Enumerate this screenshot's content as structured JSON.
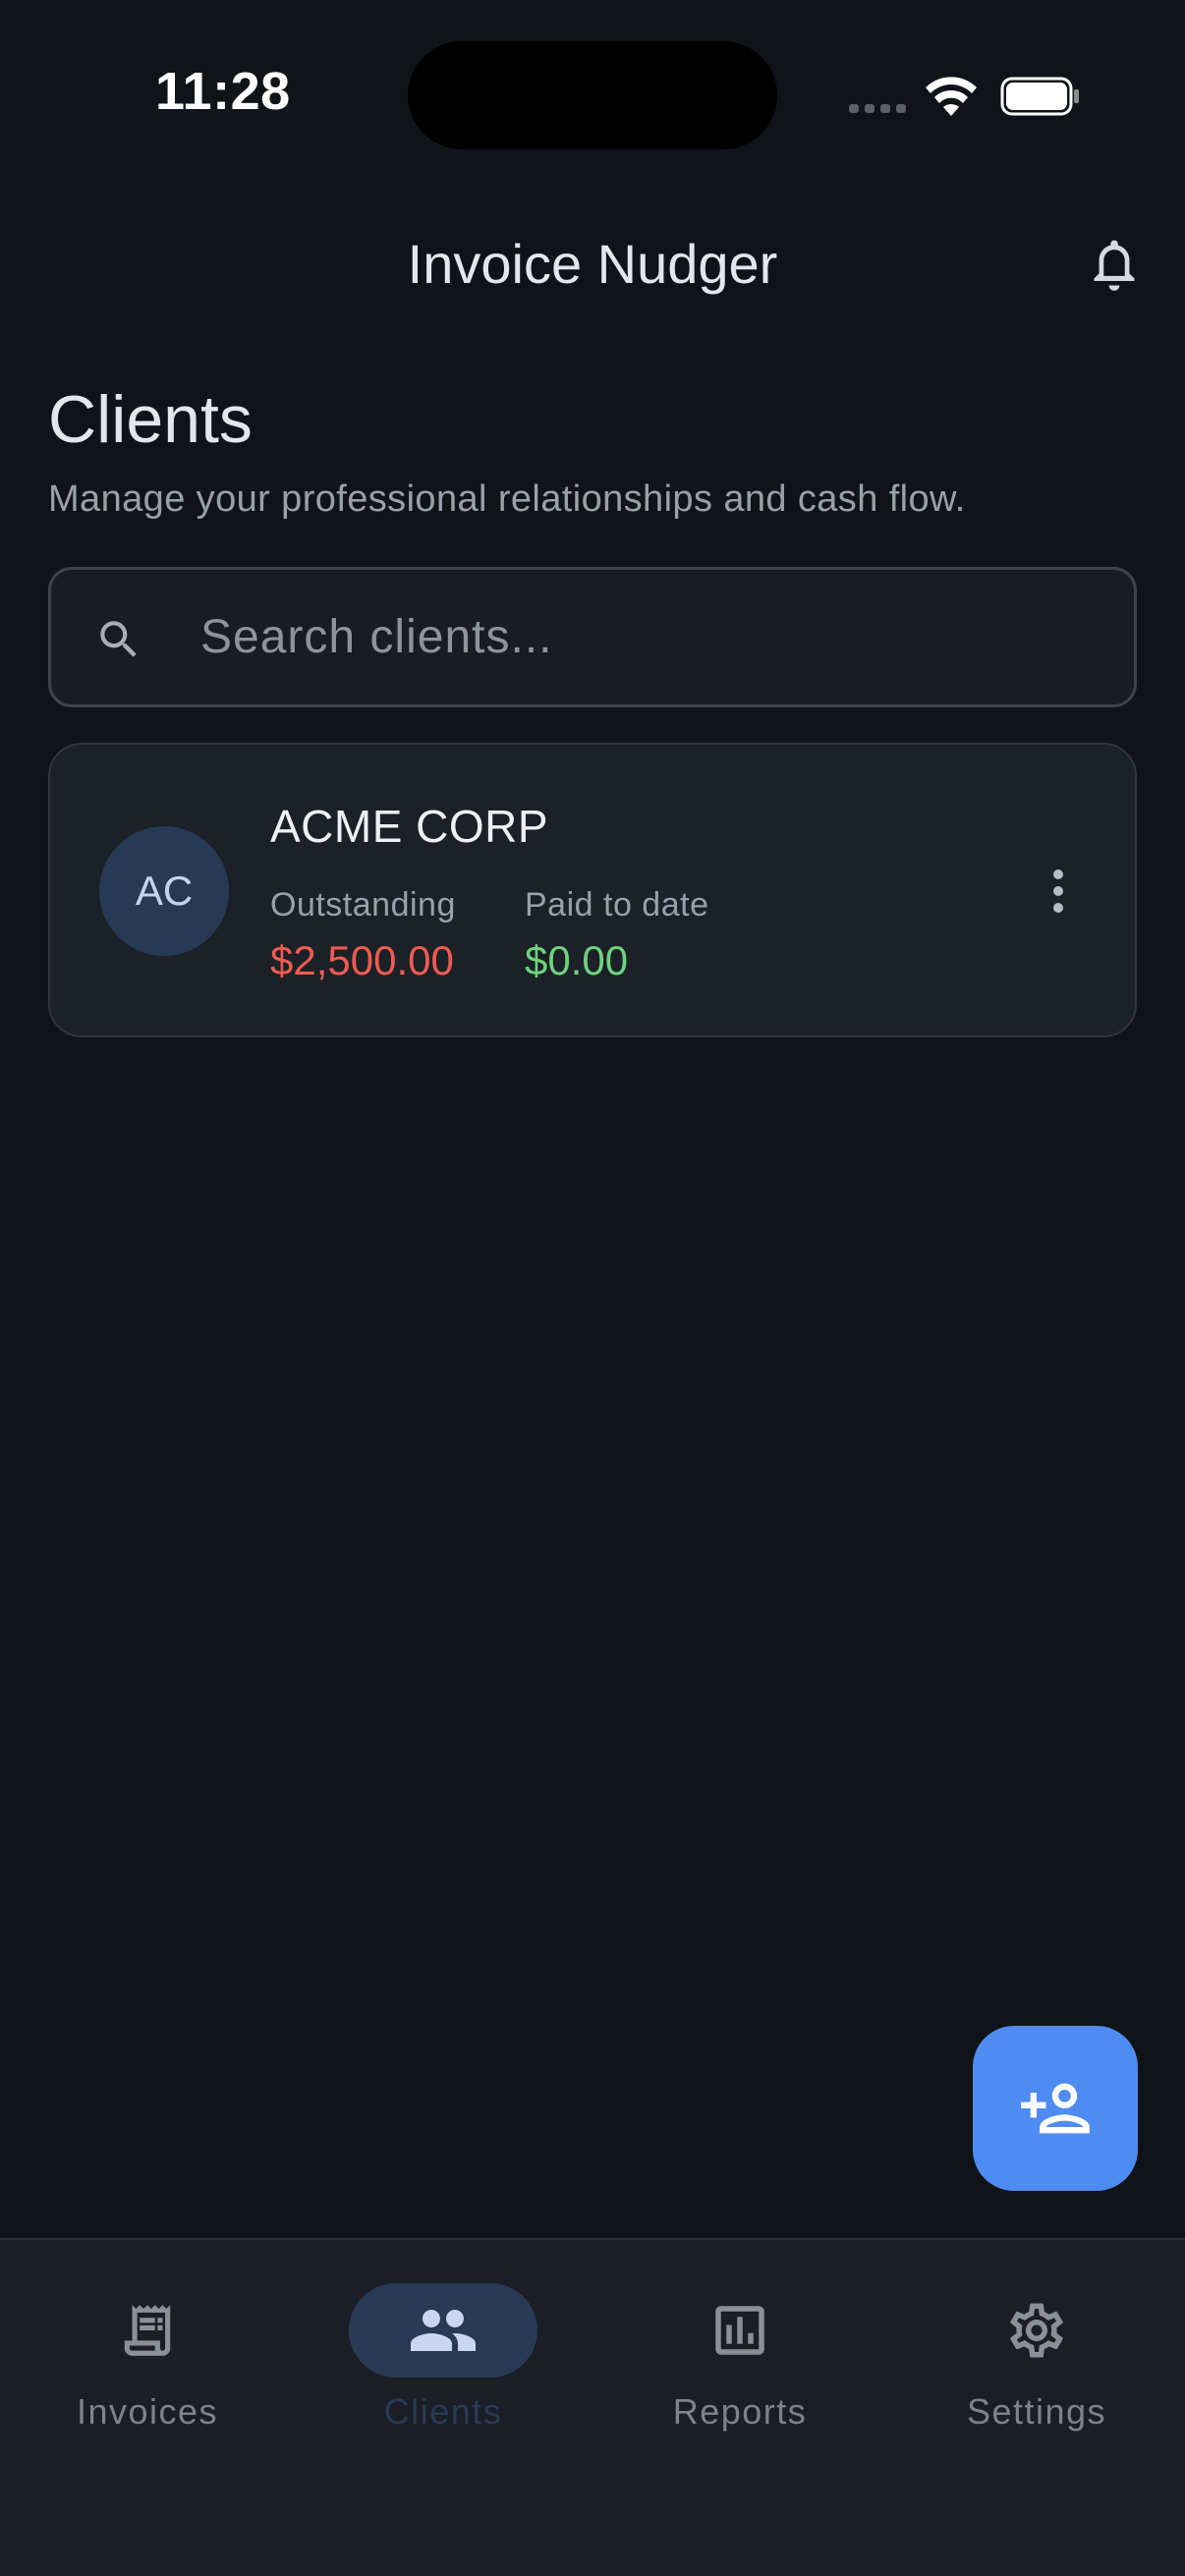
{
  "status_bar": {
    "time": "11:28"
  },
  "app_bar": {
    "title": "Invoice Nudger",
    "notification_icon": "bell-icon"
  },
  "header": {
    "title": "Clients",
    "subtitle": "Manage your professional relationships and cash flow."
  },
  "search": {
    "placeholder": "Search clients...",
    "value": "",
    "icon": "search-icon"
  },
  "clients": [
    {
      "initials": "AC",
      "name": "ACME CORP",
      "outstanding_label": "Outstanding",
      "outstanding_value": "$2,500.00",
      "paid_label": "Paid to date",
      "paid_value": "$0.00",
      "menu_icon": "more-vertical-icon"
    }
  ],
  "fab": {
    "icon": "add-person-icon"
  },
  "bottom_nav": {
    "items": [
      {
        "label": "Invoices",
        "icon": "receipt-icon",
        "active": false
      },
      {
        "label": "Clients",
        "icon": "people-icon",
        "active": true
      },
      {
        "label": "Reports",
        "icon": "bar-chart-icon",
        "active": false
      },
      {
        "label": "Settings",
        "icon": "gear-icon",
        "active": false
      }
    ]
  },
  "colors": {
    "background": "#101418",
    "accent": "#4e8cf1",
    "outstanding": "#ef5b50",
    "paid": "#6dd37d",
    "active_nav_bg": "#283a55"
  }
}
